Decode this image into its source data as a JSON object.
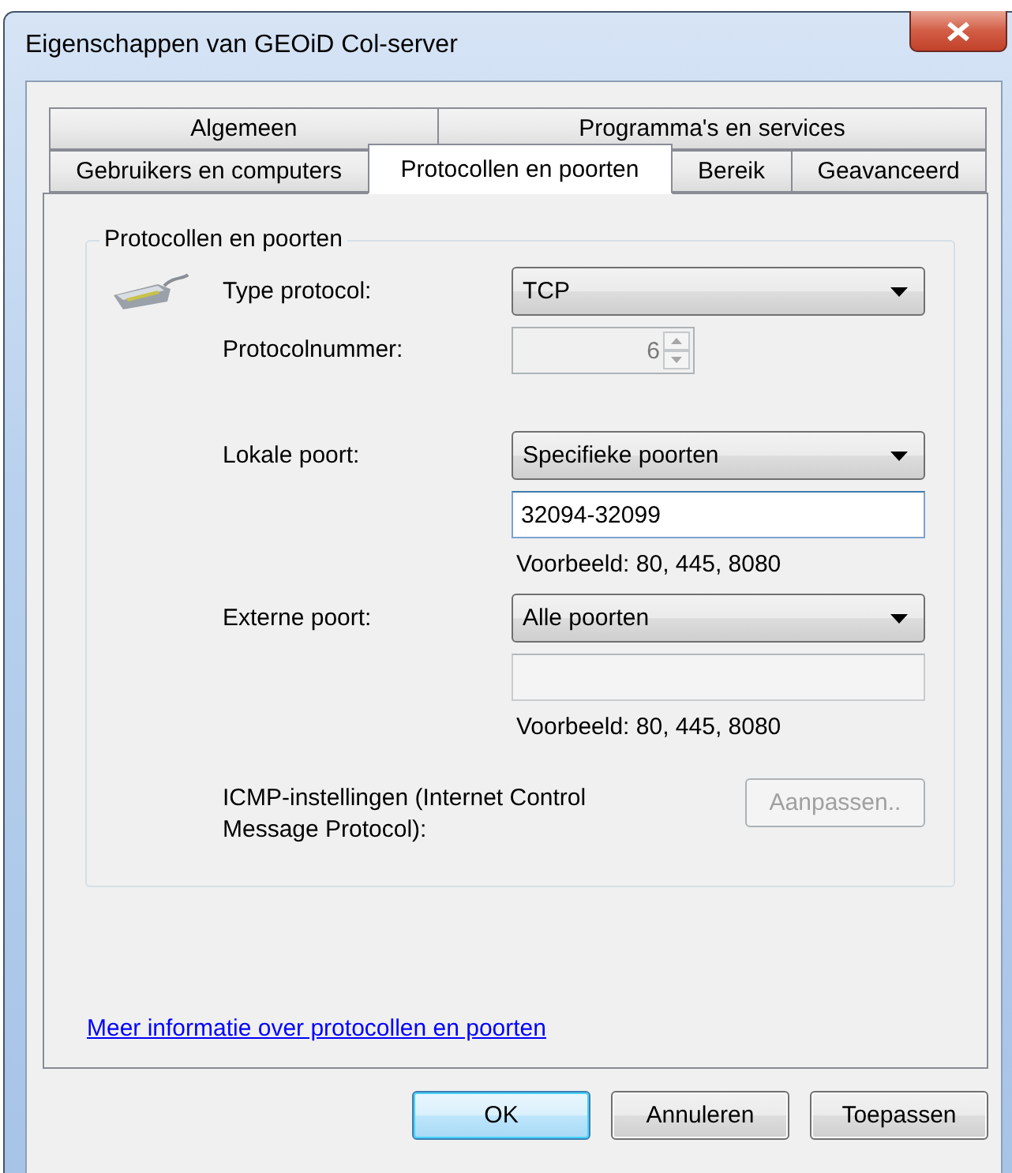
{
  "window": {
    "title": "Eigenschappen van GEOiD Col-server"
  },
  "tab_rows": [
    [
      {
        "label": "Algemeen",
        "selected": false
      },
      {
        "label": "Programma's en services",
        "selected": false
      }
    ],
    [
      {
        "label": "Gebruikers en computers",
        "selected": false
      },
      {
        "label": "Protocollen en poorten",
        "selected": true
      },
      {
        "label": "Bereik",
        "selected": false
      },
      {
        "label": "Geavanceerd",
        "selected": false
      }
    ]
  ],
  "group": {
    "title": "Protocollen en poorten"
  },
  "protocol": {
    "type_label": "Type protocol:",
    "type_value": "TCP",
    "number_label": "Protocolnummer:",
    "number_value": "6",
    "number_disabled": true
  },
  "ports": [
    {
      "label": "Lokale poort:",
      "selection": "Specifieke poorten",
      "value": "32094-32099",
      "disabled": false,
      "example": "Voorbeeld: 80, 445, 8080"
    },
    {
      "label": "Externe poort:",
      "selection": "Alle poorten",
      "disabled": true,
      "example": "Voorbeeld: 80, 445, 8080"
    }
  ],
  "icmp": {
    "label": "ICMP-instellingen (Internet Control Message Protocol):",
    "button": "Aanpassen..",
    "button_disabled": true
  },
  "link": "Meer informatie over protocollen en poorten",
  "buttons": [
    {
      "label": "OK",
      "default": true
    },
    {
      "label": "Annuleren",
      "default": false
    },
    {
      "label": "Toepassen",
      "default": false
    }
  ]
}
